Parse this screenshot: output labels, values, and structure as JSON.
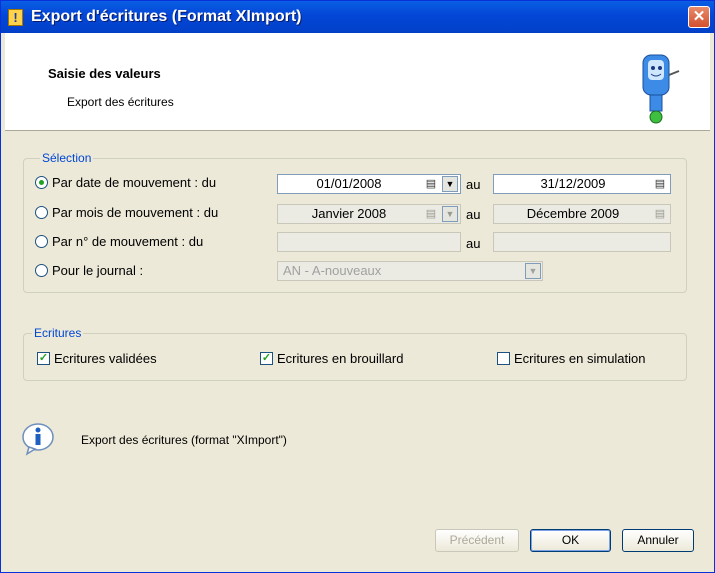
{
  "window": {
    "title": "Export d'écritures (Format XImport)",
    "close_label": "✕"
  },
  "header": {
    "title": "Saisie des valeurs",
    "subtitle": "Export des écritures"
  },
  "selection": {
    "label": "Sélection",
    "separator": "au",
    "rows": [
      {
        "label": "Par date de mouvement : du",
        "checked": true,
        "from": "01/01/2008",
        "to": "31/12/2009"
      },
      {
        "label": "Par mois de mouvement : du",
        "checked": false,
        "from": "Janvier 2008",
        "to": "Décembre 2009"
      },
      {
        "label": "Par n° de mouvement : du",
        "checked": false,
        "from": "",
        "to": ""
      },
      {
        "label": "Pour le journal :",
        "checked": false,
        "journal": "AN - A-nouveaux"
      }
    ]
  },
  "ecritures": {
    "label": "Ecritures",
    "options": [
      {
        "label": "Ecritures validées",
        "checked": true
      },
      {
        "label": "Ecritures en brouillard",
        "checked": true
      },
      {
        "label": "Ecritures en simulation",
        "checked": false
      }
    ]
  },
  "info": {
    "text": "Export des écritures (format \"XImport\")"
  },
  "buttons": {
    "previous": "Précédent",
    "ok": "OK",
    "cancel": "Annuler"
  },
  "icons": {
    "calendar": "calendar-icon",
    "dropdown": "chevron-down-icon",
    "info": "info-icon",
    "mascot": "mascot-icon"
  },
  "colors": {
    "titlebar": "#0346d6",
    "group_label": "#0046d5",
    "radio_dot": "#21a121",
    "dialog_bg": "#ece9d8"
  }
}
